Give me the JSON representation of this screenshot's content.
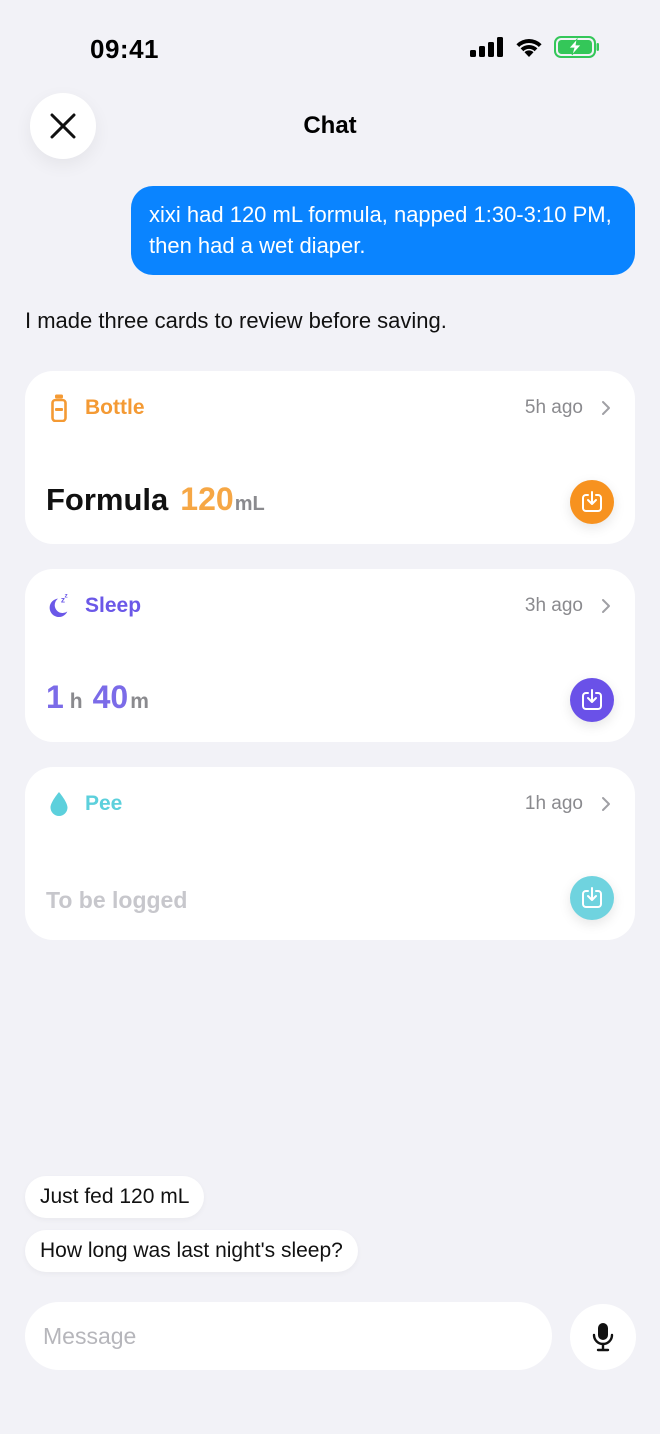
{
  "status_bar": {
    "time": "09:41"
  },
  "header": {
    "title": "Chat"
  },
  "user_message": "xixi had 120 mL formula, napped 1:30-3:10 PM, then had a wet diaper.",
  "assistant_message": "I made three cards to review before saving.",
  "cards": [
    {
      "label": "Bottle",
      "time": "5h ago",
      "icon": "bottle-icon",
      "accent": "#f49a34",
      "detail": {
        "name": "Formula",
        "value": "120",
        "unit": "mL"
      }
    },
    {
      "label": "Sleep",
      "time": "3h ago",
      "icon": "moon-zzz-icon",
      "accent": "#6b58e8",
      "detail": {
        "hours": "1",
        "hours_unit": "h",
        "minutes": "40",
        "minutes_unit": "m"
      }
    },
    {
      "label": "Pee",
      "time": "1h ago",
      "icon": "droplet-icon",
      "accent": "#5cd0dc",
      "detail": {
        "status": "To be logged"
      }
    }
  ],
  "suggestions": [
    "Just fed 120 mL",
    "How long was last night's sleep?"
  ],
  "composer": {
    "placeholder": "Message",
    "value": ""
  },
  "colors": {
    "bubble": "#0a84ff",
    "background": "#f2f2f7"
  }
}
